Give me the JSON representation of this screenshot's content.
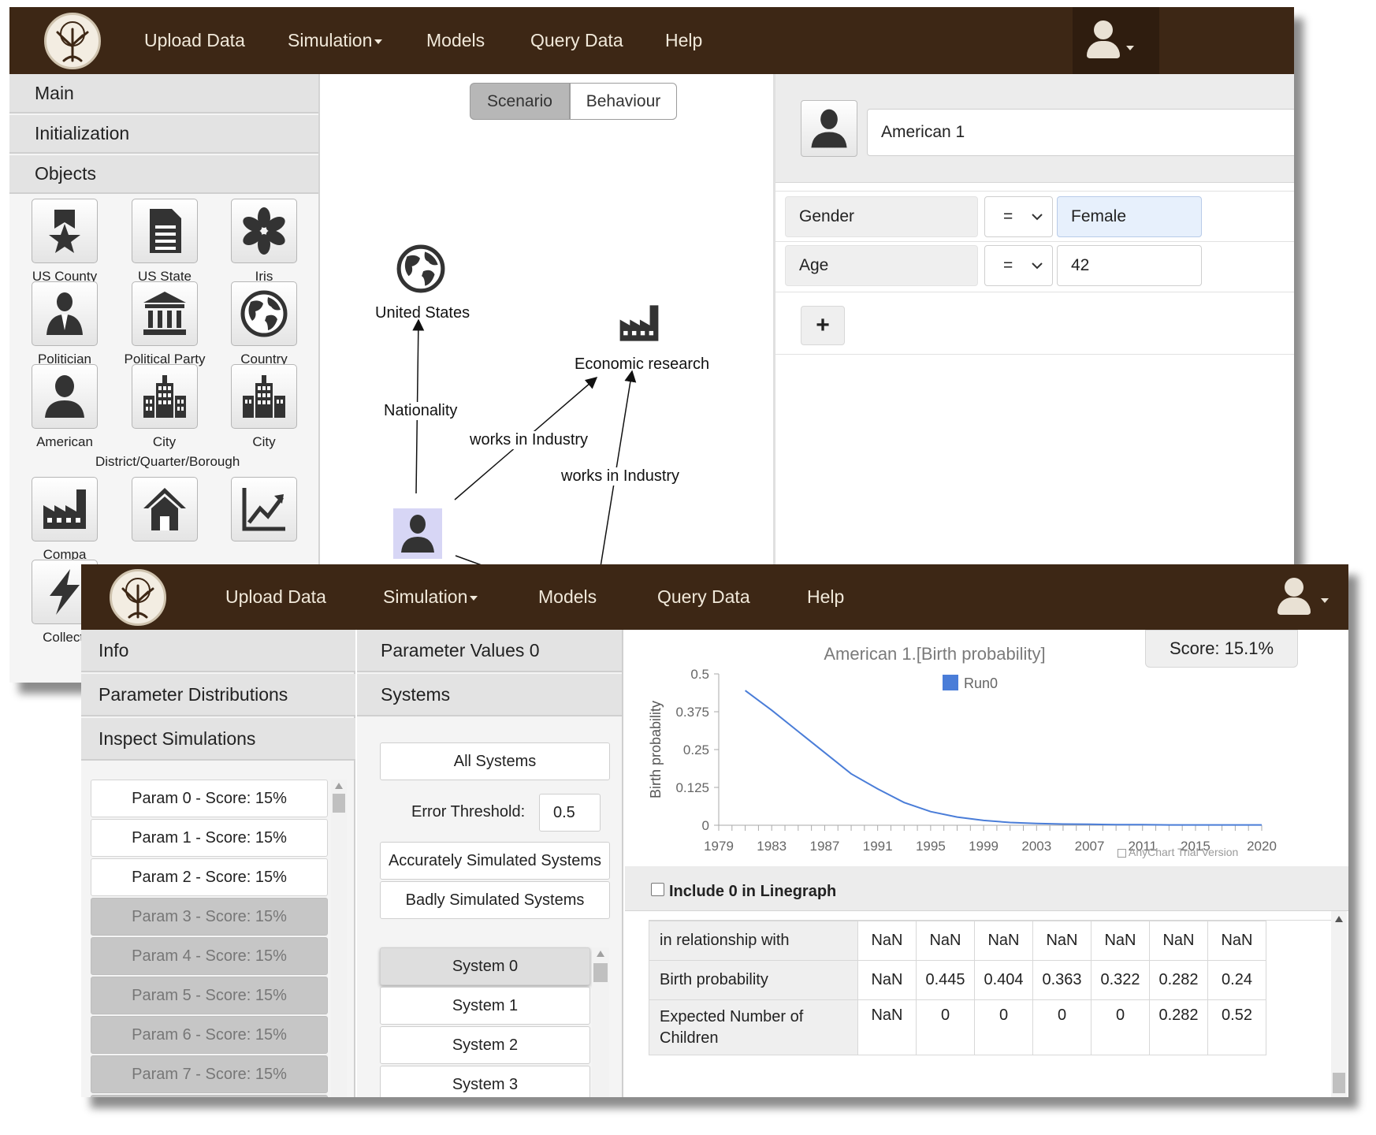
{
  "window1": {
    "nav": {
      "items": [
        "Upload Data",
        "Simulation",
        "Models",
        "Query Data",
        "Help"
      ]
    },
    "sidebar": {
      "sections": [
        "Main",
        "Initialization",
        "Objects"
      ],
      "objects": [
        {
          "label": "US County",
          "icon": "award-star-icon"
        },
        {
          "label": "US State",
          "icon": "document-icon"
        },
        {
          "label": "Iris",
          "icon": "asterisk-icon"
        },
        {
          "label": "Politician",
          "icon": "politician-icon"
        },
        {
          "label": "Political Party",
          "icon": "institution-icon"
        },
        {
          "label": "Country",
          "icon": "globe-icon"
        },
        {
          "label": "American",
          "icon": "person-icon"
        },
        {
          "label": "City District/Quarter/Borough",
          "icon": "city-icon"
        },
        {
          "label": "City",
          "icon": "city-icon"
        },
        {
          "label": "Compa",
          "icon": "factory-icon"
        },
        {
          "label": "",
          "icon": "house-icon"
        },
        {
          "label": "",
          "icon": "chart-line-icon"
        },
        {
          "label": "Collecti",
          "icon": "lightning-icon"
        }
      ]
    },
    "graph": {
      "tabs": [
        "Scenario",
        "Behaviour"
      ],
      "nodes": {
        "united_states": "United States",
        "economic_research": "Economic research",
        "american": "American 1"
      },
      "edges": {
        "nationality": "Nationality",
        "works_in_industry_1": "works in Industry",
        "works_in_industry_2": "works in Industry"
      }
    },
    "properties": {
      "object_name": "American 1",
      "rows": [
        {
          "name": "Gender",
          "operator": "=",
          "value": "Female"
        },
        {
          "name": "Age",
          "operator": "=",
          "value": "42"
        }
      ],
      "add_label": "+"
    }
  },
  "window2": {
    "nav": {
      "items": [
        "Upload Data",
        "Simulation",
        "Models",
        "Query Data",
        "Help"
      ]
    },
    "sidebar": {
      "sections": [
        "Info",
        "Parameter Distributions",
        "Inspect Simulations"
      ],
      "params": [
        "Param 0 - Score: 15%",
        "Param 1 - Score: 15%",
        "Param 2 - Score: 15%",
        "Param 3 - Score: 15%",
        "Param 4 - Score: 15%",
        "Param 5 - Score: 15%",
        "Param 6 - Score: 15%",
        "Param 7 - Score: 15%"
      ]
    },
    "systems_panel": {
      "sections": [
        "Parameter Values 0",
        "Systems"
      ],
      "all_systems": "All Systems",
      "error_threshold_label": "Error Threshold:",
      "error_threshold_value": "0.5",
      "accurate_label": "Accurately Simulated Systems",
      "bad_label": "Badly Simulated Systems",
      "systems": [
        "System 0",
        "System 1",
        "System 2",
        "System 3"
      ]
    },
    "chart": {
      "score": "Score: 15.1%",
      "watermark": "AnyChart Trial Version",
      "include_zero_label": "Include 0 in Linegraph"
    },
    "table": {
      "rows": [
        {
          "label": "in relationship with",
          "values": [
            "NaN",
            "NaN",
            "NaN",
            "NaN",
            "NaN",
            "NaN",
            "NaN"
          ]
        },
        {
          "label": "Birth probability",
          "values": [
            "NaN",
            "0.445",
            "0.404",
            "0.363",
            "0.322",
            "0.282",
            "0.24"
          ]
        },
        {
          "label": "Expected Number of Children",
          "values": [
            "NaN",
            "0",
            "0",
            "0",
            "0",
            "0.282",
            "0.52"
          ]
        }
      ]
    }
  },
  "chart_data": {
    "type": "line",
    "title": "American 1.[Birth probability]",
    "ylabel": "Birth probability",
    "xlabel": "",
    "ylim": [
      0,
      0.5
    ],
    "yticks": [
      0,
      0.125,
      0.25,
      0.375,
      0.5
    ],
    "xticks": [
      1979,
      1983,
      1987,
      1991,
      1995,
      1999,
      2003,
      2007,
      2011,
      2015,
      2020
    ],
    "legend_position": "top-center",
    "series": [
      {
        "name": "Run0",
        "color": "#4a7dd8",
        "x": [
          1981,
          1983,
          1985,
          1987,
          1989,
          1991,
          1993,
          1995,
          1997,
          1999,
          2001,
          2003,
          2005,
          2007,
          2009,
          2011,
          2013,
          2015,
          2017,
          2020
        ],
        "y": [
          0.445,
          0.38,
          0.31,
          0.24,
          0.17,
          0.12,
          0.075,
          0.045,
          0.027,
          0.016,
          0.009,
          0.006,
          0.004,
          0.003,
          0.002,
          0.002,
          0.001,
          0.001,
          0.001,
          0.001
        ]
      }
    ]
  },
  "colors": {
    "navbar": "#3d2715",
    "selected_field": "#e7f0fc",
    "series": "#4a7dd8"
  }
}
